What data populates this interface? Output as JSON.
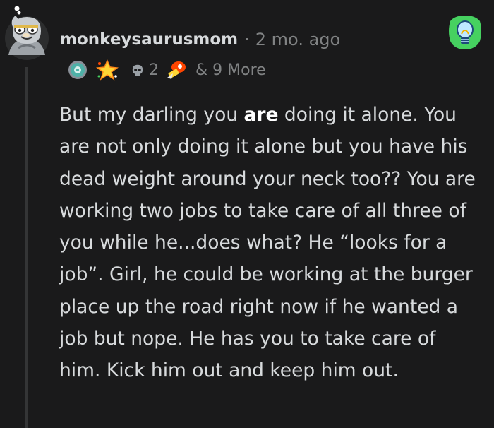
{
  "comment": {
    "author": "monkeysaurusmom",
    "separator": "·",
    "age": "2 mo. ago",
    "awards": {
      "icons": [
        "silver-cog-award-icon",
        "starstruck-award-icon",
        "skull-award-icon",
        "rocket-award-icon"
      ],
      "count_label": "2",
      "more_label": "& 9 More"
    },
    "flair_icon": "lightbulb-icon",
    "body": {
      "before_bold": "But my darling you ",
      "bold": "are",
      "after_bold": " doing it alone. You are not only doing it alone but you have his dead weight around your neck too?? You are working two jobs to take care of all three of you while he...does what? He “looks for a job”. Girl, he could be working at the burger place up the road right now if he wanted a job but nope. He has you to take care of him. Kick him out and keep him out."
    }
  },
  "colors": {
    "background": "#1a1a1b",
    "text": "#d7dadc",
    "meta": "#818384",
    "thread_line": "#343536",
    "flair_background": "#46d160"
  }
}
